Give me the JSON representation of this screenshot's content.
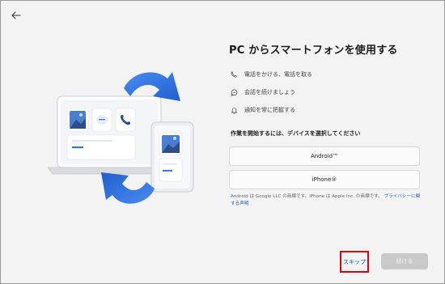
{
  "title": "PC からスマートフォンを使用する",
  "features": [
    {
      "icon": "phone-icon",
      "label": "電話をかける、電話を取る"
    },
    {
      "icon": "chat-icon",
      "label": "会話を続けましょう"
    },
    {
      "icon": "bell-icon",
      "label": "通知を常に把握する"
    }
  ],
  "prompt": "作業を開始するには、デバイスを選択してください",
  "devices": {
    "android": "Android™",
    "iphone": "iPhone®"
  },
  "footnote": {
    "text": "Android は Google LLC の商標です。iPhone は Apple Inc. の商標です。",
    "link": "プライバシーに関する声明"
  },
  "buttons": {
    "skip": "スキップ",
    "next": "続ける"
  },
  "colors": {
    "accent": "#0a5aa8",
    "highlight": "#e3000f",
    "arrow": "#2a6ee0"
  }
}
